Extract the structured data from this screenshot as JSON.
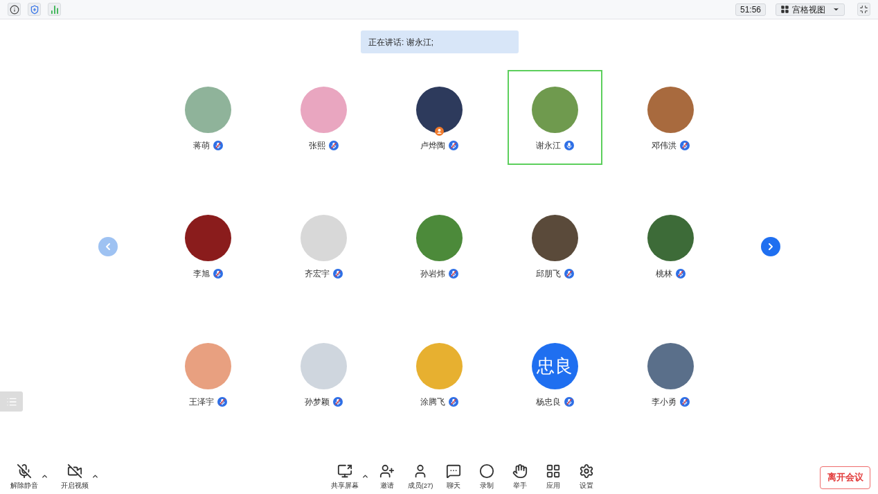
{
  "top_bar": {
    "timer": "51:56",
    "view_menu": {
      "label": "宫格视图"
    }
  },
  "speaker_banner": "正在讲话: 谢永江;",
  "participants": [
    {
      "name": "蒋萌",
      "muted": true,
      "selected": false,
      "host": false
    },
    {
      "name": "张熙",
      "muted": true,
      "selected": false,
      "host": false
    },
    {
      "name": "卢烨陶",
      "muted": true,
      "selected": false,
      "host": true
    },
    {
      "name": "谢永江",
      "muted": false,
      "selected": true,
      "host": false
    },
    {
      "name": "邓伟洪",
      "muted": true,
      "selected": false,
      "host": false
    },
    {
      "name": "李旭",
      "muted": true,
      "selected": false,
      "host": false
    },
    {
      "name": "齐宏宇",
      "muted": true,
      "selected": false,
      "host": false
    },
    {
      "name": "孙岩炜",
      "muted": true,
      "selected": false,
      "host": false
    },
    {
      "name": "邱朋飞",
      "muted": true,
      "selected": false,
      "host": false
    },
    {
      "name": "桃林",
      "muted": true,
      "selected": false,
      "host": false
    },
    {
      "name": "王泽宇",
      "muted": true,
      "selected": false,
      "host": false
    },
    {
      "name": "孙梦颖",
      "muted": true,
      "selected": false,
      "host": false
    },
    {
      "name": "涂腾飞",
      "muted": true,
      "selected": false,
      "host": false
    },
    {
      "name": "杨忠良",
      "muted": true,
      "selected": false,
      "host": false,
      "initials": "忠良"
    },
    {
      "name": "李小勇",
      "muted": true,
      "selected": false,
      "host": false
    }
  ],
  "toolbar_left": [
    {
      "kind": "unmute",
      "label": "解除静音",
      "menu": true
    },
    {
      "kind": "video",
      "label": "开启视频",
      "menu": true
    }
  ],
  "toolbar_center": [
    {
      "kind": "share",
      "label": "共享屏幕",
      "menu": true
    },
    {
      "kind": "invite",
      "label": "邀请",
      "menu": false
    },
    {
      "kind": "members",
      "label": "成员(27)",
      "menu": false
    },
    {
      "kind": "chat",
      "label": "聊天",
      "menu": false
    },
    {
      "kind": "record",
      "label": "录制",
      "menu": false
    },
    {
      "kind": "hand",
      "label": "举手",
      "menu": false
    },
    {
      "kind": "apps",
      "label": "应用",
      "menu": false
    },
    {
      "kind": "settings",
      "label": "设置",
      "menu": false
    }
  ],
  "leave_button": "离开会议"
}
